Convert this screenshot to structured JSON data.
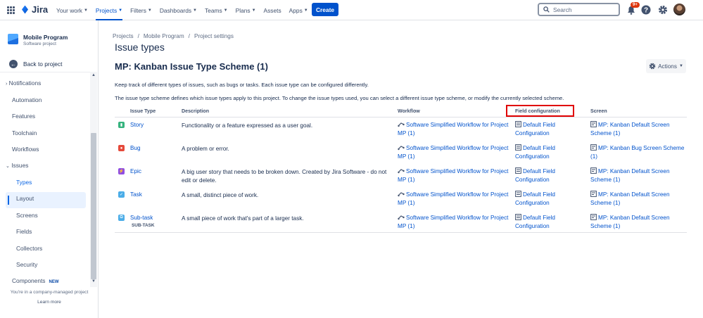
{
  "topnav": {
    "logo": "Jira",
    "items": [
      {
        "label": "Your work"
      },
      {
        "label": "Projects"
      },
      {
        "label": "Filters"
      },
      {
        "label": "Dashboards"
      },
      {
        "label": "Teams"
      },
      {
        "label": "Plans"
      },
      {
        "label": "Assets"
      },
      {
        "label": "Apps"
      }
    ],
    "create_label": "Create",
    "search_placeholder": "Search",
    "notification_count": "9+"
  },
  "sidebar": {
    "project_name": "Mobile Program",
    "project_type": "Software project",
    "back_label": "Back to project",
    "items": [
      {
        "label": "Notifications"
      },
      {
        "label": "Automation"
      },
      {
        "label": "Features"
      },
      {
        "label": "Toolchain"
      },
      {
        "label": "Workflows"
      },
      {
        "label": "Issues"
      },
      {
        "label": "Types"
      },
      {
        "label": "Layout"
      },
      {
        "label": "Screens"
      },
      {
        "label": "Fields"
      },
      {
        "label": "Collectors"
      },
      {
        "label": "Security"
      },
      {
        "label": "Components"
      }
    ],
    "new_badge": "NEW",
    "footer_text": "You're in a company-managed project",
    "footer_link": "Learn more"
  },
  "breadcrumb": [
    "Projects",
    "/",
    "Mobile Program",
    "/",
    "Project settings"
  ],
  "page_title": "Issue types",
  "scheme_title": "MP: Kanban Issue Type Scheme (1)",
  "actions_label": "Actions",
  "intro_1": "Keep track of different types of issues, such as bugs or tasks. Each issue type can be configured differently.",
  "intro_2": "The issue type scheme defines which issue types apply to this project. To change the issue types used, you can select a different issue type scheme, or modify the currently selected scheme.",
  "table": {
    "headers": [
      "Issue Type",
      "Description",
      "Workflow",
      "Field configuration",
      "Screen"
    ],
    "rows": [
      {
        "name": "Story",
        "tag": "",
        "color": "#36b37e",
        "desc": "Functionality or a feature expressed as a user goal.",
        "workflow": "Software Simplified Workflow for Project MP (1)",
        "field_config": "Default Field Configuration",
        "screen": "MP: Kanban Default Screen Scheme (1)"
      },
      {
        "name": "Bug",
        "tag": "",
        "color": "#e5493a",
        "desc": "A problem or error.",
        "workflow": "Software Simplified Workflow for Project MP (1)",
        "field_config": "Default Field Configuration",
        "screen": "MP: Kanban Bug Screen Scheme (1)"
      },
      {
        "name": "Epic",
        "tag": "",
        "color": "#904ee2",
        "desc": "A big user story that needs to be broken down. Created by Jira Software - do not edit or delete.",
        "workflow": "Software Simplified Workflow for Project MP (1)",
        "field_config": "Default Field Configuration",
        "screen": "MP: Kanban Default Screen Scheme (1)"
      },
      {
        "name": "Task",
        "tag": "",
        "color": "#4bade8",
        "desc": "A small, distinct piece of work.",
        "workflow": "Software Simplified Workflow for Project MP (1)",
        "field_config": "Default Field Configuration",
        "screen": "MP: Kanban Default Screen Scheme (1)"
      },
      {
        "name": "Sub-task",
        "tag": "SUB-TASK",
        "color": "#4bade8",
        "desc": "A small piece of work that's part of a larger task.",
        "workflow": "Software Simplified Workflow for Project MP (1)",
        "field_config": "Default Field Configuration",
        "screen": "MP: Kanban Default Screen Scheme (1)"
      }
    ]
  },
  "colors": {
    "accent": "#0052cc",
    "highlight": "#e00000"
  }
}
